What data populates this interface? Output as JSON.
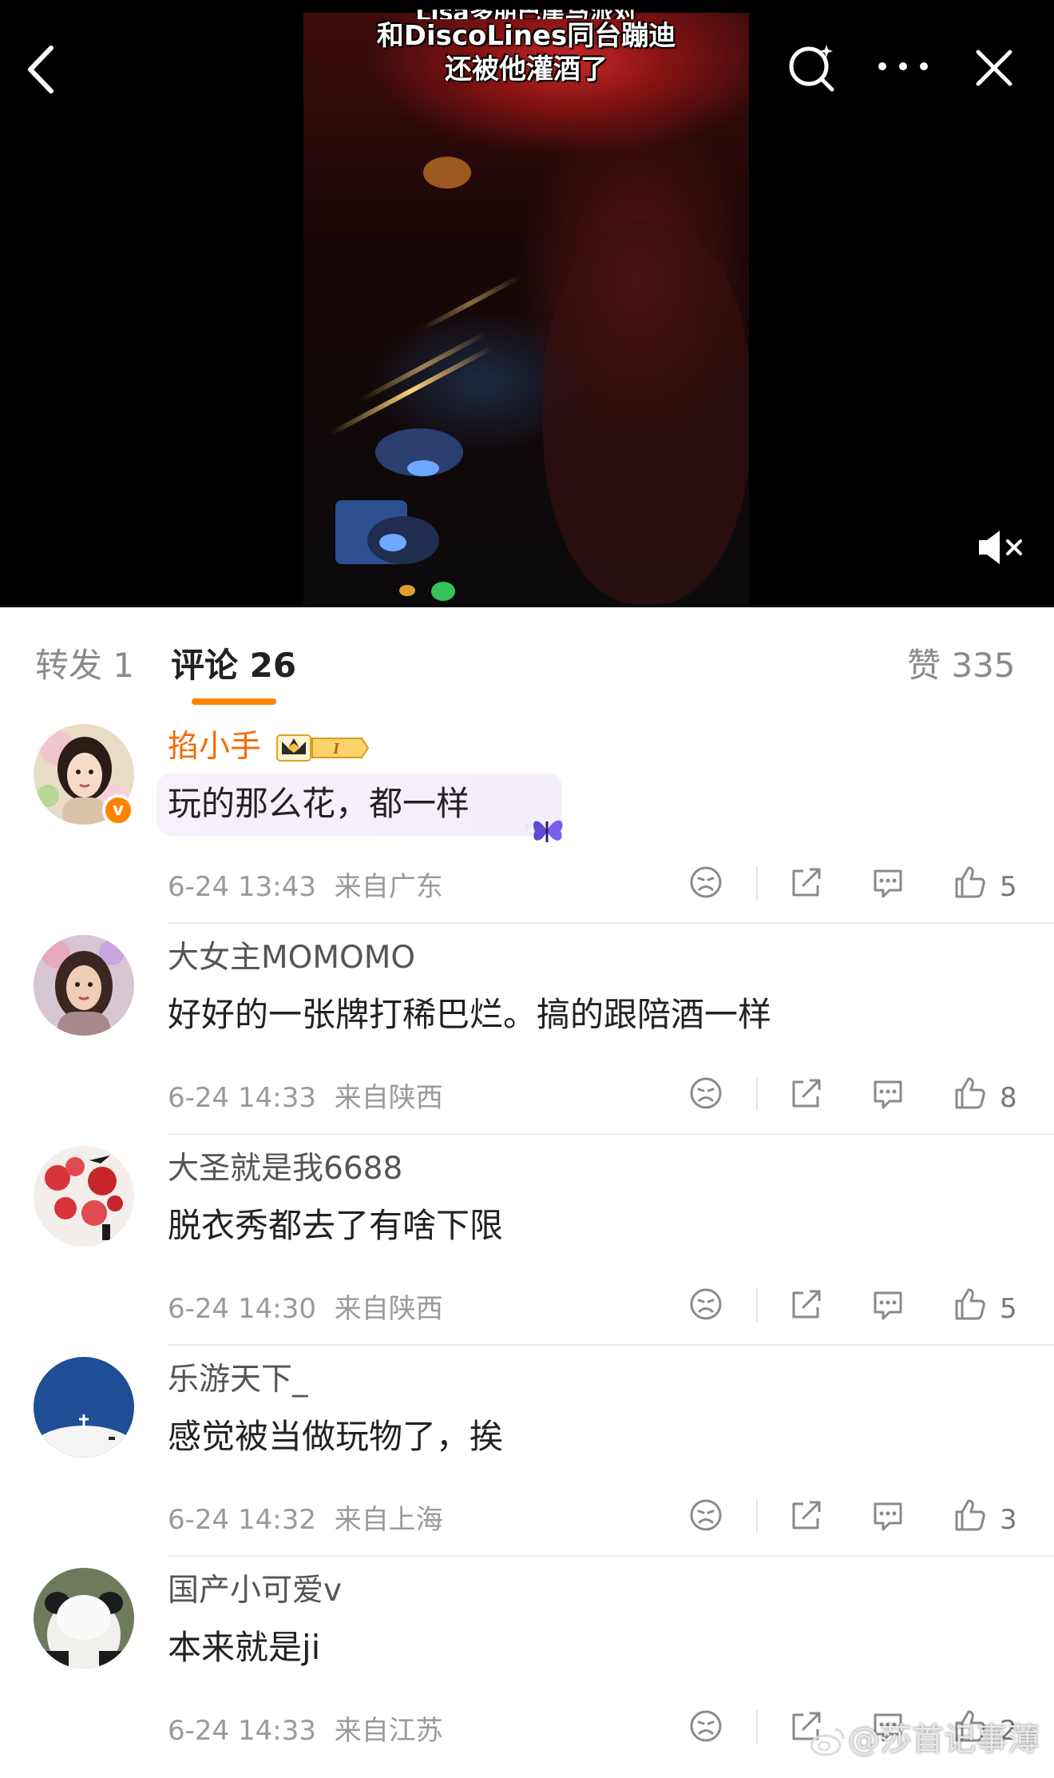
{
  "video": {
    "caption_partial": "Lisa多朋巴崖马派对",
    "caption_line1": "和DiscoLines同台蹦迪",
    "caption_line2": "还被他灌酒了"
  },
  "topbar": {
    "back_icon": "chevron-left-icon",
    "search_icon": "search-sparkle-icon",
    "more_icon": "more-dots-icon",
    "close_icon": "close-icon",
    "mute_icon": "mute-speaker-icon"
  },
  "tabs": {
    "repost": "转发 1",
    "comments": "评论 26",
    "likes": "赞 335"
  },
  "colors": {
    "accent": "#ff8200",
    "vip_name": "#f56b0a",
    "text": "#222222",
    "meta": "#9a9a9a"
  },
  "comments": [
    {
      "username": "掐小手",
      "vip": true,
      "level_badge": "I",
      "text": "玩的那么花，都一样",
      "time": "6-24 13:43",
      "location": "来自广东",
      "likes": "5"
    },
    {
      "username": "大女主MOMOMO",
      "text": "好好的一张牌打稀巴烂。搞的跟陪酒一样",
      "time": "6-24 14:33",
      "location": "来自陕西",
      "likes": "8"
    },
    {
      "username": "大圣就是我6688",
      "text": "脱衣秀都去了有啥下限",
      "time": "6-24 14:30",
      "location": "来自陕西",
      "likes": "5"
    },
    {
      "username": "乐游天下_",
      "text": "感觉被当做玩物了，挨",
      "time": "6-24 14:32",
      "location": "来自上海",
      "likes": "3"
    },
    {
      "username": "国产小可爱v",
      "text": "本来就是ji",
      "time": "6-24 14:33",
      "location": "来自江苏",
      "likes": "2"
    }
  ],
  "watermark": "@莎首记事薄"
}
